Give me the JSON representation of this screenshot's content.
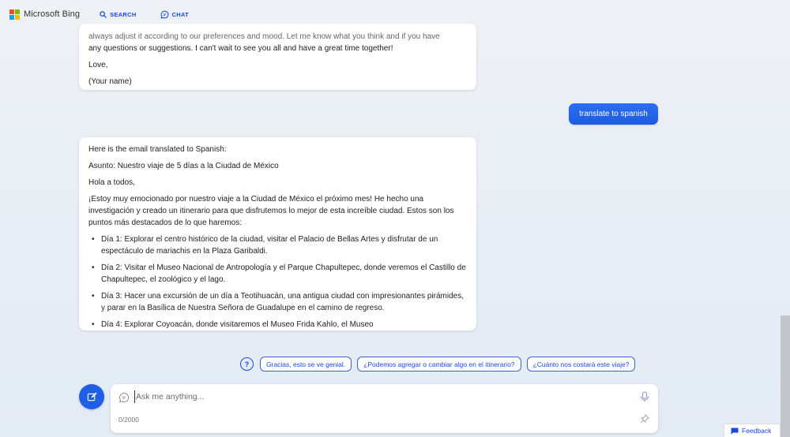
{
  "header": {
    "brand": "Microsoft Bing",
    "logo_colors": [
      "#f25022",
      "#7fba00",
      "#00a4ef",
      "#ffb900"
    ],
    "tabs": [
      {
        "label": "SEARCH",
        "icon": "search-icon"
      },
      {
        "label": "CHAT",
        "icon": "chat-icon",
        "active": true
      }
    ]
  },
  "conversation": {
    "previous_reply": {
      "line1": "always adjust it according to our preferences and mood. Let me know what you think and if you have",
      "line2": "any questions or suggestions. I can't wait to see you all and have a great time together!",
      "signoff": "Love,",
      "signature": "(Your name)"
    },
    "user_message": "translate to spanish",
    "reply": {
      "intro": "Here is the email translated to Spanish:",
      "subject": "Asunto: Nuestro viaje de 5 días a la Ciudad de México",
      "greeting": "Hola a todos,",
      "paragraph": "¡Estoy muy emocionado por nuestro viaje a la Ciudad de México el próximo mes! He hecho una investigación y creado un itinerario para que disfrutemos lo mejor de esta increíble ciudad. Estos son los puntos más destacados de lo que haremos:",
      "items": [
        "Día 1: Explorar el centro histórico de la ciudad, visitar el Palacio de Bellas Artes y disfrutar de un espectáculo de mariachis en la Plaza Garibaldi.",
        "Día 2: Visitar el Museo Nacional de Antropología y el Parque Chapultepec, donde veremos el Castillo de Chapultepec, el zoológico y el lago.",
        "Día 3: Hacer una excursión de un día a Teotihuacán, una antigua ciudad con impresionantes pirámides, y parar en la Basílica de Nuestra Señora de Guadalupe en el camino de regreso.",
        "Día 4: Explorar Coyoacán, donde visitaremos el Museo Frida Kahlo, el Museo"
      ]
    }
  },
  "suggestions": [
    "Gracias, esto se ve genial.",
    "¿Podemos agregar o cambiar algo en el itinerario?",
    "¿Cuánto nos costará este viaje?"
  ],
  "composer": {
    "placeholder": "Ask me anything...",
    "counter": "0/2000"
  },
  "feedback_label": "Feedback",
  "colors": {
    "accent": "#174ae4",
    "user_bubble": "#1d5ce0"
  }
}
